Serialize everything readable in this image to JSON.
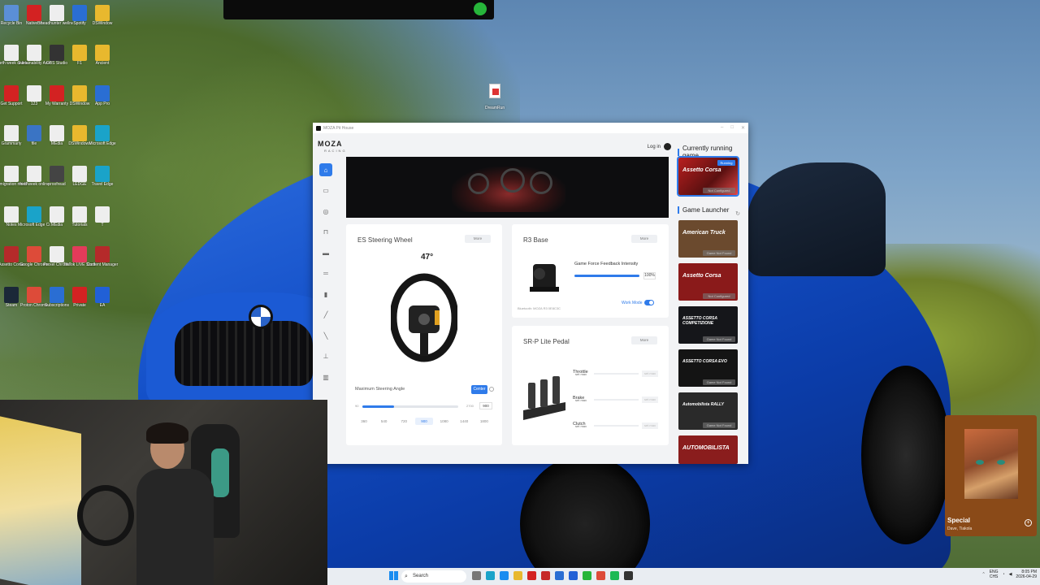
{
  "window": {
    "title": "MOZA Pit House",
    "brand": "MOZA",
    "brand_sub": "RACING",
    "login": "Log in"
  },
  "desktop": {
    "icons": [
      {
        "label": "Recycle Bin",
        "color": "#5b8fd6"
      },
      {
        "label": "NativeBit",
        "color": "#d32222"
      },
      {
        "label": "headhunter wellness",
        "color": "#eeeeee"
      },
      {
        "label": "Spotify",
        "color": "#2a6ed3"
      },
      {
        "label": "DSWindow",
        "color": "#e8b82e"
      },
      {
        "label": "fourth week online",
        "color": "#eeeeee"
      },
      {
        "label": "Sustainability Assignment",
        "color": "#eeeeee"
      },
      {
        "label": "OBS Studio",
        "color": "#333333"
      },
      {
        "label": "F1",
        "color": "#e8b82e"
      },
      {
        "label": "Ancient",
        "color": "#e8b82e"
      },
      {
        "label": "Get Support",
        "color": "#d32222"
      },
      {
        "label": "123",
        "color": "#eeeeee"
      },
      {
        "label": "My Warranty",
        "color": "#d32222"
      },
      {
        "label": "DSWindow",
        "color": "#e8b82e"
      },
      {
        "label": "App Pro",
        "color": "#2a6ed3"
      },
      {
        "label": "Grammarly",
        "color": "#eeeeee"
      },
      {
        "label": "file",
        "color": "#3a74c4"
      },
      {
        "label": "MEdia",
        "color": "#eeeeee"
      },
      {
        "label": "DSWindows",
        "color": "#e8b82e"
      },
      {
        "label": "Microsoft Edge",
        "color": "#1aa3c9"
      },
      {
        "label": "nomigration modifier",
        "color": "#eeeeee"
      },
      {
        "label": "third week online",
        "color": "#eeeeee"
      },
      {
        "label": "proofread",
        "color": "#444444"
      },
      {
        "label": "LEDGE",
        "color": "#eeeeee"
      },
      {
        "label": "Travel Edge",
        "color": "#1aa3c9"
      },
      {
        "label": "Notes",
        "color": "#eeeeee"
      },
      {
        "label": "Microsoft Edge Copy",
        "color": "#1aa3c9"
      },
      {
        "label": "MEdia",
        "color": "#eeeeee"
      },
      {
        "label": "Tutorials",
        "color": "#eeeeee"
      },
      {
        "label": "T",
        "color": "#eeeeee"
      },
      {
        "label": "Assetto Corsa",
        "color": "#b52a2a"
      },
      {
        "label": "Google Chrome",
        "color": "#dd4b39"
      },
      {
        "label": "Prexel Chrome",
        "color": "#eeeeee"
      },
      {
        "label": "TikTok LIVE Studio",
        "color": "#e33b5a"
      },
      {
        "label": "Content Manager",
        "color": "#b52a2a"
      },
      {
        "label": "Steam",
        "color": "#1b2838"
      },
      {
        "label": "Proton Chrome",
        "color": "#dd4b39"
      },
      {
        "label": "Subscriptions",
        "color": "#2a6ed3"
      },
      {
        "label": "Private",
        "color": "#d32222"
      },
      {
        "label": "EA",
        "color": "#2160d6"
      }
    ],
    "floating_file": "DreamRun"
  },
  "nav": [
    "home-icon",
    "wheel-base-icon",
    "steering-wheel-icon",
    "pedal-icon",
    "dash-icon",
    "shifter-icon",
    "handbrake-icon",
    "stalk-icon",
    "sequential-icon",
    "hub-icon",
    "settings-icon"
  ],
  "wheel_card": {
    "title": "ES Steering Wheel",
    "more": "More",
    "angle": "47°",
    "max_angle_label": "Maximum Steering Angle",
    "center_button": "Center",
    "slider_min": "90",
    "slider_max": "2700",
    "slider_value": "900",
    "slider_fill": 0.33,
    "presets": [
      "360",
      "540",
      "720",
      "900",
      "1080",
      "1440",
      "1800"
    ],
    "active_preset": 3
  },
  "base_card": {
    "title": "R3 Base",
    "more": "More",
    "ffb_label": "Game Force Feedback Intensity",
    "ffb_value": "100%",
    "ffb_fill": 1.0,
    "bluetooth": "Bluetooth: MOZA R3 0E8C3C",
    "work_mode": "Work Mode"
  },
  "pedal_card": {
    "title": "SR-P Lite Pedal",
    "more": "More",
    "rows": [
      {
        "name": "Throttle",
        "set": "set max",
        "value": "set max"
      },
      {
        "name": "Brake",
        "set": "set max",
        "value": "set max"
      },
      {
        "name": "Clutch",
        "set": "set max",
        "value": "set max"
      }
    ]
  },
  "right_panel": {
    "current_title": "Currently running game",
    "launcher_title": "Game Launcher",
    "current_game": {
      "title": "Assetto Corsa",
      "running": "Running",
      "status": "Not Configured"
    },
    "games": [
      {
        "title": "American Truck",
        "status": "Game Not Found",
        "color": "#6b4a2e"
      },
      {
        "title": "Assetto Corsa",
        "status": "Not Configured",
        "color": "#8a1a1a"
      },
      {
        "title": "ASSETTO CORSA COMPETIZIONE",
        "status": "Game Not Found",
        "color": "#15161a"
      },
      {
        "title": "ASSETTO CORSA EVO",
        "status": "Game Not Found",
        "color": "#141414"
      },
      {
        "title": "Automobilista RALLY",
        "status": "Game Not Found",
        "color": "#2a2a2a"
      },
      {
        "title": "AUTOMOBILISTA",
        "status": "",
        "color": "#8a1d1d"
      }
    ]
  },
  "music": {
    "title": "Special",
    "artist": "Dave, Tiakola"
  },
  "taskbar": {
    "search": "Search",
    "lang_1": "ENG",
    "lang_2": "CHS",
    "time": "8:05 PM",
    "date": "2026-04-29"
  }
}
